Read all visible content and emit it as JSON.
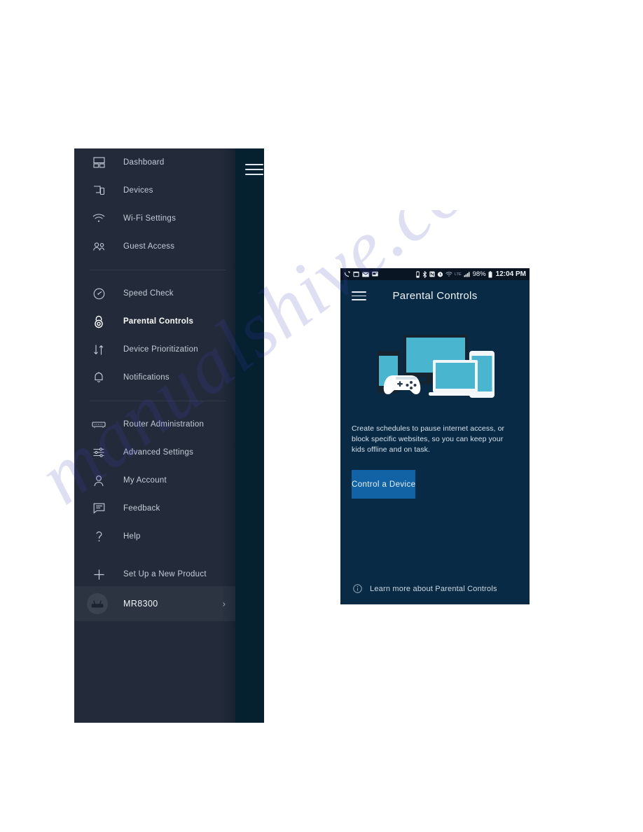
{
  "watermark": {
    "text": "manualshive.com"
  },
  "drawer": {
    "menu_toggle_icon": "hamburger-icon",
    "items": [
      {
        "label": "Dashboard",
        "icon": "dashboard-icon",
        "active": false
      },
      {
        "label": "Devices",
        "icon": "devices-icon",
        "active": false
      },
      {
        "label": "Wi-Fi Settings",
        "icon": "wifi-icon",
        "active": false
      },
      {
        "label": "Guest Access",
        "icon": "guest-users-icon",
        "active": false
      },
      {
        "label": "Speed Check",
        "icon": "speedometer-icon",
        "active": false
      },
      {
        "label": "Parental Controls",
        "icon": "lock-icon",
        "active": true
      },
      {
        "label": "Device Prioritization",
        "icon": "up-down-arrows-icon",
        "active": false
      },
      {
        "label": "Notifications",
        "icon": "bell-icon",
        "active": false
      },
      {
        "label": "Router Administration",
        "icon": "router-icon",
        "active": false
      },
      {
        "label": "Advanced Settings",
        "icon": "sliders-icon",
        "active": false
      },
      {
        "label": "My Account",
        "icon": "person-icon",
        "active": false
      },
      {
        "label": "Feedback",
        "icon": "chat-bubble-icon",
        "active": false
      },
      {
        "label": "Help",
        "icon": "question-mark-icon",
        "active": false
      },
      {
        "label": "Set Up a New Product",
        "icon": "plus-icon",
        "active": false
      }
    ],
    "device": {
      "name": "MR8300",
      "avatar_icon": "router-device-icon",
      "chevron_icon": "chevron-right-icon"
    }
  },
  "phone": {
    "status_bar": {
      "left_icons": [
        "call-forwarding-icon",
        "calendar-icon",
        "mail-icon",
        "messages-icon"
      ],
      "right_icons": [
        "vibrate-icon",
        "bluetooth-icon",
        "nfc-icon",
        "alarm-icon",
        "wifi-icon",
        "lte-label",
        "signal-bars-icon"
      ],
      "lte_label": "LTE",
      "battery_percent": "98%",
      "battery_icon": "battery-full-icon",
      "time": "12:04 PM"
    },
    "app_bar": {
      "menu_icon": "hamburger-icon",
      "title": "Parental Controls"
    },
    "hero": {
      "illustration": "devices-illustration",
      "devices": [
        "monitor",
        "smartphone",
        "laptop",
        "tablet",
        "game-controller"
      ]
    },
    "blurb": "Create schedules to pause internet access, or block specific websites, so you can keep your kids offline and on task.",
    "cta_label": "Control a Device",
    "footer": {
      "info_icon": "info-circle-icon",
      "label": "Learn more about Parental Controls"
    }
  },
  "colors": {
    "drawer_bg": "#232b3a",
    "drawer_strip": "#05202f",
    "phone_bg": "#082a44",
    "status_bar_bg": "#0a1524",
    "cta_bg": "#1263a5",
    "screen_teal": "#3fb3cf",
    "text_muted": "#c3ccd8"
  }
}
